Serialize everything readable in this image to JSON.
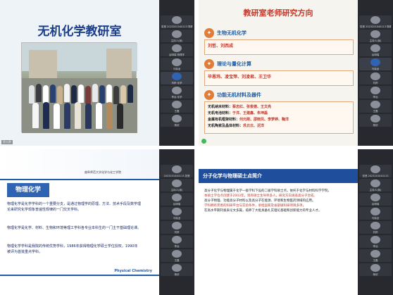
{
  "q1": {
    "slide_title": "无机化学教研室",
    "presenter": "聂允鹏",
    "participants": [
      "张慧 2023201040113 物理学",
      "主持人(我)",
      "谷明瑞 物理学",
      "马晓龙",
      "刘婷 化学",
      "李远 化学",
      "王磊",
      "杨欣",
      "邓欣",
      "陈晨"
    ]
  },
  "q2": {
    "slide_title": "教研室老师研究方向",
    "section1_label": "生物无机化学",
    "section1_people": "刘哲、刘西成",
    "section2_label": "理论与量化计算",
    "section2_people": "毕恩玮、凌宝萍、刘凌君、王卫华",
    "section3_label": "功能无机材料及器件",
    "section3_rows": [
      {
        "k": "无机纳米材料：",
        "v": "蔡志红、张俊德、王文亮"
      },
      {
        "k": "无机电池材料：",
        "v": "于洋、王建鑫、朱坤磊"
      },
      {
        "k": "金属有机框架材料：",
        "v": "何元刚、邵晓凤、李梦婷、鞠洋"
      },
      {
        "k": "无机陶瓷及晶体材料：",
        "v": "巩云云、迟洋"
      }
    ],
    "participants": [
      "张慧 2023201040113 物理学",
      "主持人(我)",
      "谷明瑞",
      "马晓龙",
      "刘婷",
      "李远",
      "王磊",
      "杨欣",
      "邓欣"
    ]
  },
  "q3": {
    "school": "曲阜师范大学化学与化工学院",
    "heading": "物理化学",
    "paras": [
      "物理化学是化学学科的一个重要分支，是通过物理学的原理、方法、技术手段及数学理论来研究化学现象普遍性规律的一门交叉学科。",
      "物理化学是化学、材料、生物和环境等理工学科各专业本科生的一门主干基础理论课。",
      "物理化学学科是我院的传统优势学科，1986年获得物理化学硕士学位授权，1990年被评为首批重点学科。"
    ],
    "footer": "Physical Chemistry",
    "participants": [
      "2023201040113 张慧",
      "主持人(我)",
      "谷明瑞",
      "马晓龙",
      "刘婷",
      "李远",
      "王磊",
      "杨欣",
      "邓欣",
      "陈晨"
    ]
  },
  "q4": {
    "heading": "分子化学与物理硕士点简介",
    "body": [
      "高分子化学与物理属于化学一级学科下设的二级学科硕士点，依托于化学与材料科学学院，",
      "本硕士学位点创建于2003年，现有硕士生导师多人，研究方向涵盖高分子合成、",
      "高分子物理、功能高分子材料以及高分子在能源、环境和生物医药领域的应用。",
      "学科拥有完善的科研平台与实验条件，承担国家及省部级科研项目多项，",
      "在高水平期刊发表论文多篇，培养了大批具备扎实理论基础和创新能力的专业人才。"
    ],
    "participants": [
      "张慧 2023201040113",
      "主持人(我)",
      "谷明瑞",
      "马晓龙",
      "刘婷",
      "李远",
      "王磊",
      "杨欣",
      "邓欣",
      "陈晨"
    ]
  }
}
